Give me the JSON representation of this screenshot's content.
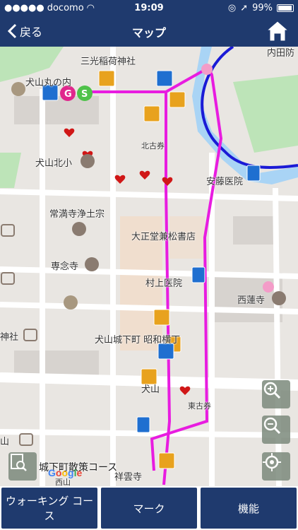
{
  "status": {
    "carrier": "docomo",
    "time": "19:09",
    "battery": "99%"
  },
  "nav": {
    "back_label": "戻る",
    "title": "マップ"
  },
  "map": {
    "labels": {
      "inuyama_maru": "犬山丸の内",
      "mitsuinari": "三光稲荷神社",
      "uchida": "内田防",
      "kitako": "北古券",
      "inuyama_kita": "犬山北小",
      "ando": "安藤医院",
      "jomanji": "常満寺浄土宗",
      "taisho": "大正堂兼松書店",
      "sennenji": "専念寺",
      "murakami": "村上医院",
      "nishirenji": "西蓮寺",
      "jinja": "神社",
      "jokamachi": "犬山城下町 昭和横丁",
      "inuyama": "犬山",
      "higashiko": "東古券",
      "yama": "山",
      "nishiyama": "西山",
      "shounji": "祥雲寺"
    },
    "course_label": "城下町散策コース",
    "google": "Google"
  },
  "tabs": {
    "walking": "ウォーキング コース",
    "mark": "マーク",
    "function": "機能"
  },
  "colors": {
    "nav": "#1f3a6e",
    "route": "#e81ce0",
    "river": "#1a1ad6",
    "map_bg": "#e9e6e2"
  }
}
